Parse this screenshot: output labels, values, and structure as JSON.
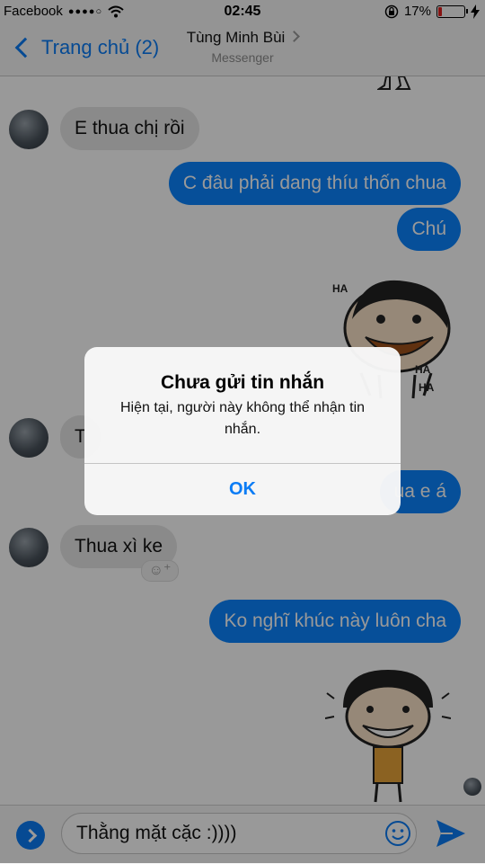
{
  "status_bar": {
    "carrier": "Facebook",
    "signal_dots": "●●●●○",
    "time": "02:45",
    "battery": "17%",
    "battery_level": 0.17
  },
  "nav": {
    "back_label": "Trang chủ (2)",
    "contact_name": "Tùng Minh Bùi",
    "subtitle": "Messenger"
  },
  "messages": [
    {
      "from": "them",
      "text": "E thua chị rồi"
    },
    {
      "from": "me",
      "text": "C đâu phải dang thíu thốn chua"
    },
    {
      "from": "me",
      "text": "Chú"
    },
    {
      "from": "me",
      "type": "sticker",
      "text": ""
    },
    {
      "from": "them",
      "text": "T"
    },
    {
      "from": "me",
      "text": "ua e á"
    },
    {
      "from": "them",
      "text": "Thua xì ke"
    },
    {
      "from": "me",
      "text": "Ko nghĩ khúc này luôn cha"
    },
    {
      "from": "me",
      "type": "sticker",
      "text": ""
    }
  ],
  "sticker_texts": [
    "HA",
    "HA",
    "HA"
  ],
  "composer": {
    "text": "Thằng mặt cặc :))))"
  },
  "alert": {
    "title": "Chưa gửi tin nhắn",
    "message": "Hiện tại, người này không thể nhận tin nhắn.",
    "ok_label": "OK"
  },
  "colors": {
    "accent": "#0b7cf5",
    "outgoing_bubble": "#0b84ff",
    "incoming_bubble": "#e6e6e6"
  }
}
